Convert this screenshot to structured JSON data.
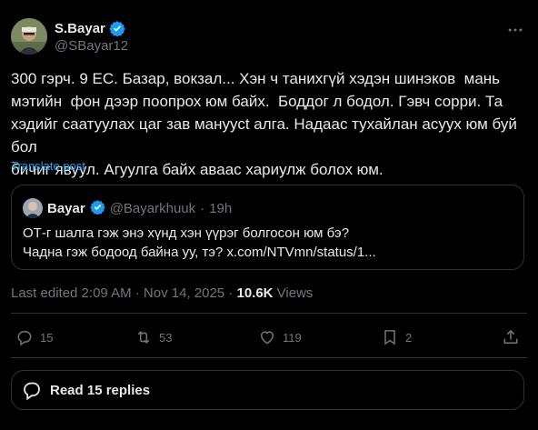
{
  "author": {
    "display_name": "S.Bayar",
    "handle": "@SBayar12",
    "verified": true
  },
  "post": {
    "text": "300 гэрч. 9 ЕС. Базар, вокзал... Хэн ч танихгүй хэдэн шинэков  мань\nмэтийн  фон дээр поопрох юм байх.  Боддог л бодол. Гэвч сорри. Та\nхэдийг саатуулах цаг зав мануусt алга. Надаас тухайлан асуух юм буй бол\nбичиг явуул. Агуулга байх аваас хариулж болох юм.",
    "translate_label": "Translate post"
  },
  "quote": {
    "display_name": "Bayar",
    "handle": "@Bayarkhuuk",
    "dot": "·",
    "time": "19h",
    "line1": "ОТ-г шалга гэж энэ хүнд хэн үүрэг болгосон юм бэ?",
    "line2": "Чадна гэж бодоод байна уу, тэ? x.com/NTVmn/status/1..."
  },
  "meta": {
    "edited": "Last edited 2:09 AM · Nov 14, 2025 · ",
    "views_count": "10.6K",
    "views_label": " Views"
  },
  "actions": {
    "replies": "15",
    "reposts": "53",
    "likes": "119",
    "bookmarks": "2"
  },
  "read_replies": {
    "label": "Read 15 replies"
  },
  "colors": {
    "background": "#000000",
    "text": "#e7e9ea",
    "muted": "#71767b",
    "accent": "#1d9bf0",
    "border": "#2f3336"
  },
  "icons": [
    "verified-badge-icon",
    "more-icon",
    "reply-icon",
    "repost-icon",
    "like-icon",
    "bookmark-icon",
    "share-icon",
    "chat-bubble-icon"
  ]
}
